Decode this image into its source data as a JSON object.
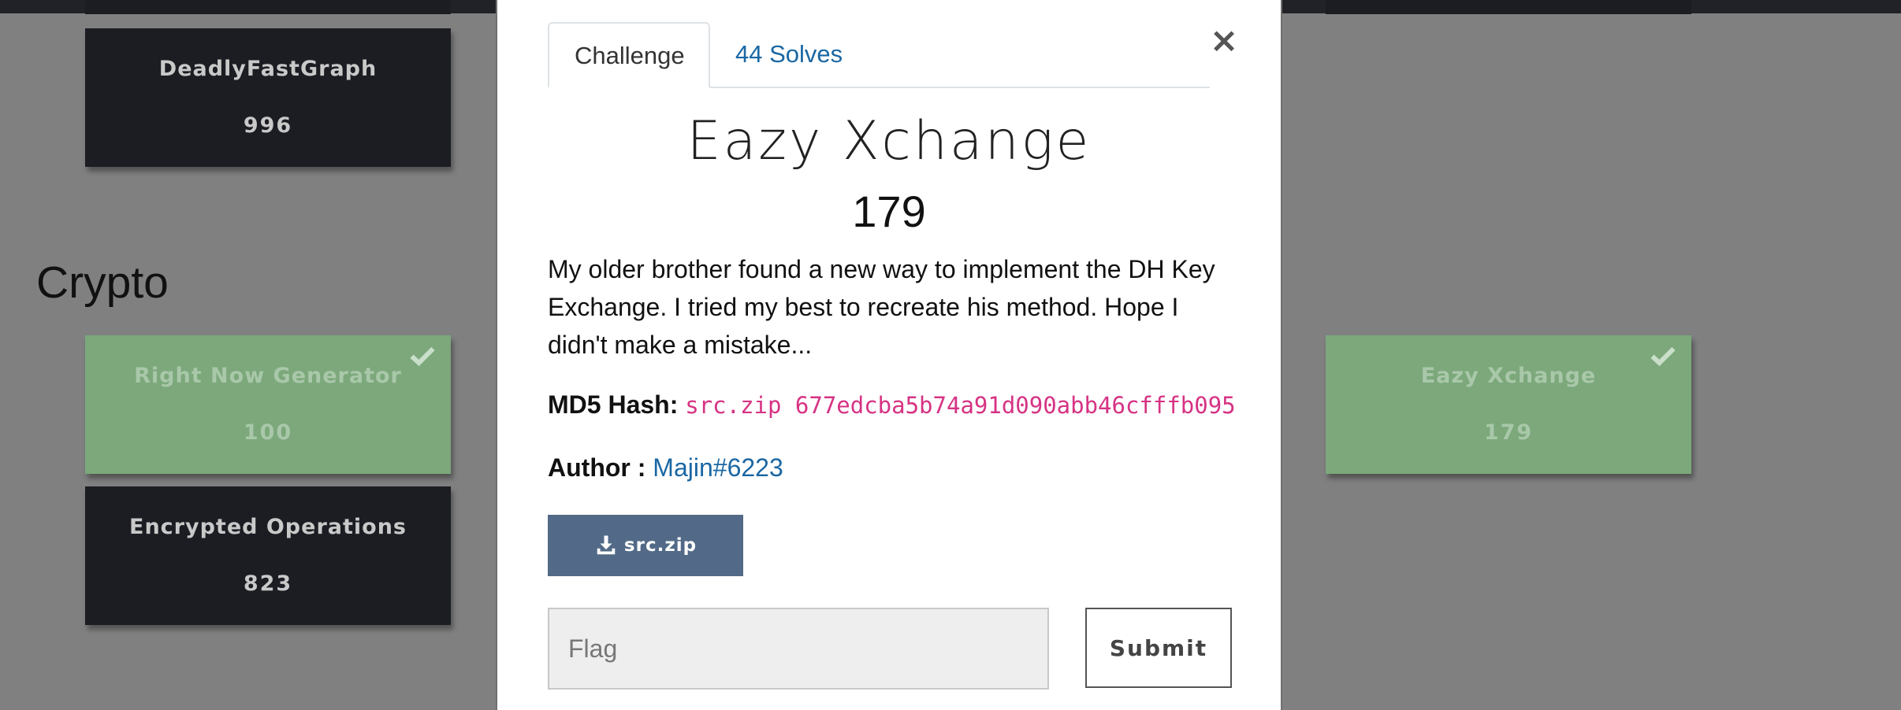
{
  "background_cards": {
    "top_left": {
      "name": "DeadlyFastGraph",
      "value": "996",
      "solved": false
    },
    "category": "Crypto",
    "crypto_cards": [
      {
        "name": "Right Now Generator",
        "value": "100",
        "solved": true
      },
      {
        "name": "Encrypted Operations",
        "value": "823",
        "solved": false
      },
      {
        "name": "Eazy Xchange",
        "value": "179",
        "solved": true
      }
    ]
  },
  "modal": {
    "tabs": [
      {
        "label": "Challenge",
        "active": true
      },
      {
        "label": "44 Solves",
        "active": false
      }
    ],
    "close_label": "×",
    "title": "Eazy Xchange",
    "value": "179",
    "description": "My older brother found a new way to implement the DH Key Exchange. I tried my best to recreate his method. Hope I didn't make a mistake...",
    "hash_label": "MD5 Hash:",
    "hash_value": "src.zip 677edcba5b74a91d090abb46cfffb095",
    "author_label": "Author :",
    "author_value": "Majin#6223",
    "file_label": "src.zip",
    "flag_placeholder": "Flag",
    "flag_value": "",
    "submit_label": "Submit"
  },
  "colors": {
    "backdrop": "#808080",
    "card_dark": "#1b1d23",
    "card_solved": "#7ca87c",
    "link": "#1a67a3",
    "hash": "#d63384",
    "download_button": "#526a87"
  }
}
